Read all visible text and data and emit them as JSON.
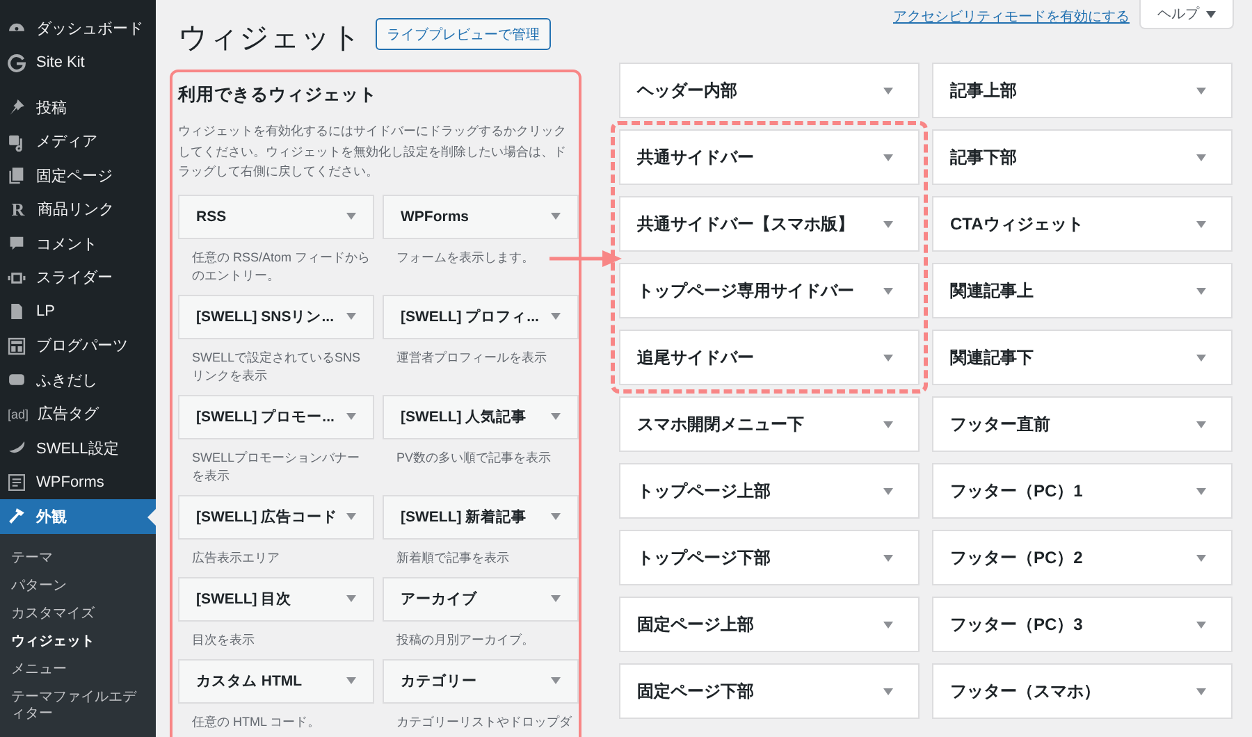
{
  "sidebar": {
    "groups": [
      {
        "items": [
          {
            "label": "ダッシュボード",
            "kind": "gauge",
            "selected": false
          },
          {
            "label": "Site Kit",
            "kind": "g",
            "selected": false
          }
        ]
      },
      {
        "items": [
          {
            "label": "投稿",
            "kind": "pin",
            "selected": false
          },
          {
            "label": "メディア",
            "kind": "media",
            "selected": false
          },
          {
            "label": "固定ページ",
            "kind": "pages",
            "selected": false
          },
          {
            "label": "商品リンク",
            "kind": "text",
            "icon_text": "R",
            "selected": false
          },
          {
            "label": "コメント",
            "kind": "comment",
            "selected": false
          },
          {
            "label": "スライダー",
            "kind": "slider",
            "selected": false
          },
          {
            "label": "LP",
            "kind": "page",
            "selected": false
          },
          {
            "label": "ブログパーツ",
            "kind": "grid",
            "selected": false
          },
          {
            "label": "ふきだし",
            "kind": "bubble",
            "selected": false
          },
          {
            "label": "広告タグ",
            "kind": "text",
            "icon_text": "[ad]",
            "selected": false
          },
          {
            "label": "SWELL設定",
            "kind": "leaf",
            "selected": false
          },
          {
            "label": "WPForms",
            "kind": "form",
            "selected": false
          },
          {
            "label": "外観",
            "kind": "brush",
            "selected": true,
            "submenu": [
              {
                "label": "テーマ",
                "selected": false
              },
              {
                "label": "パターン",
                "selected": false
              },
              {
                "label": "カスタマイズ",
                "selected": false
              },
              {
                "label": "ウィジェット",
                "selected": true
              },
              {
                "label": "メニュー",
                "selected": false
              },
              {
                "label": "テーマファイルエディター",
                "selected": false
              }
            ]
          }
        ]
      }
    ]
  },
  "header": {
    "title": "ウィジェット",
    "preview_button": "ライブプレビューで管理",
    "accessibility_link": "アクセシビリティモードを有効にする",
    "help_button": "ヘルプ"
  },
  "available_widgets": {
    "title": "利用できるウィジェット",
    "description": "ウィジェットを有効化するにはサイドバーにドラッグするかクリックしてください。ウィジェットを無効化し設定を削除したい場合は、ドラッグして右側に戻してください。",
    "widgets": [
      {
        "name": "RSS",
        "description": "任意の RSS/Atom フィードからのエントリー。"
      },
      {
        "name": "WPForms",
        "description": "フォームを表示します。"
      },
      {
        "name": "[SWELL] SNSリン...",
        "description": "SWELLで設定されているSNSリンクを表示"
      },
      {
        "name": "[SWELL] プロフィ...",
        "description": "運営者プロフィールを表示"
      },
      {
        "name": "[SWELL] プロモー...",
        "description": "SWELLプロモーションバナーを表示"
      },
      {
        "name": "[SWELL] 人気記事",
        "description": "PV数の多い順で記事を表示"
      },
      {
        "name": "[SWELL] 広告コード",
        "description": "広告表示エリア"
      },
      {
        "name": "[SWELL] 新着記事",
        "description": "新着順で記事を表示"
      },
      {
        "name": "[SWELL] 目次",
        "description": "目次を表示"
      },
      {
        "name": "アーカイブ",
        "description": "投稿の月別アーカイブ。"
      },
      {
        "name": "カスタム HTML",
        "description": "任意の HTML コード。"
      },
      {
        "name": "カテゴリー",
        "description": "カテゴリーリストやドロップダ"
      }
    ]
  },
  "widget_area_columns": [
    {
      "areas": [
        {
          "name": "ヘッダー内部",
          "highlighted": false
        },
        {
          "name": "共通サイドバー",
          "highlighted": true
        },
        {
          "name": "共通サイドバー【スマホ版】",
          "highlighted": true
        },
        {
          "name": "トップページ専用サイドバー",
          "highlighted": true
        },
        {
          "name": "追尾サイドバー",
          "highlighted": true
        },
        {
          "name": "スマホ開閉メニュー下",
          "highlighted": false
        },
        {
          "name": "トップページ上部",
          "highlighted": false
        },
        {
          "name": "トップページ下部",
          "highlighted": false
        },
        {
          "name": "固定ページ上部",
          "highlighted": false
        },
        {
          "name": "固定ページ下部",
          "highlighted": false
        }
      ]
    },
    {
      "areas": [
        {
          "name": "記事上部",
          "highlighted": false
        },
        {
          "name": "記事下部",
          "highlighted": false
        },
        {
          "name": "CTAウィジェット",
          "highlighted": false
        },
        {
          "name": "関連記事上",
          "highlighted": false
        },
        {
          "name": "関連記事下",
          "highlighted": false
        },
        {
          "name": "フッター直前",
          "highlighted": false
        },
        {
          "name": "フッター（PC）1",
          "highlighted": false
        },
        {
          "name": "フッター（PC）2",
          "highlighted": false
        },
        {
          "name": "フッター（PC）3",
          "highlighted": false
        },
        {
          "name": "フッター（スマホ）",
          "highlighted": false
        }
      ]
    }
  ]
}
